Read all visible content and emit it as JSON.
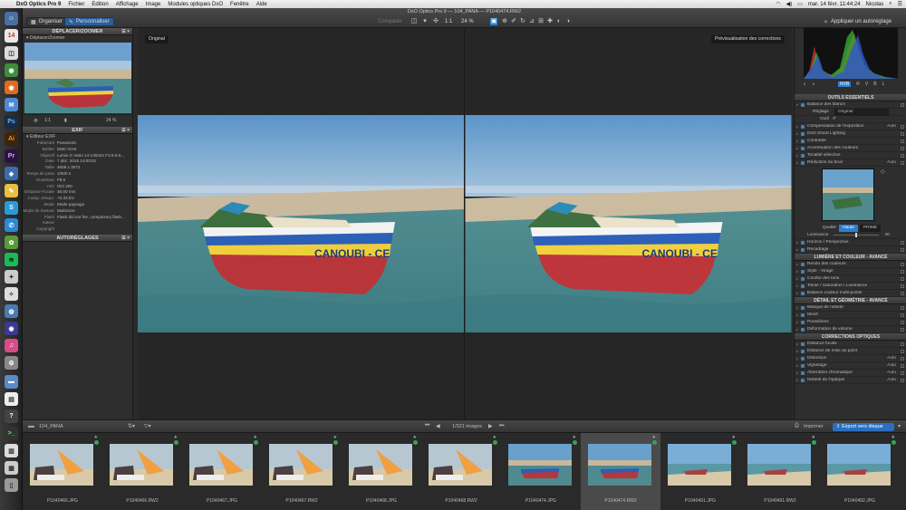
{
  "menubar": {
    "app": "DxO Optics Pro 9",
    "items": [
      "Fichier",
      "Edition",
      "Affichage",
      "Image",
      "Modules optiques DxO",
      "Fenêtre",
      "Aide"
    ],
    "clock": "mar. 14 févr. 11:44:24",
    "user": "Nicolas"
  },
  "toolbar": {
    "window_title": "DxO Optics Pro 9 — 104_PANA — P1040474.RW2",
    "tab_organize": "Organiser",
    "tab_customize": "Personnaliser",
    "compare_label": "Comparer",
    "zoom_ratio": "1:1",
    "zoom_percent": "24 %",
    "auto_apply": "Appliquer un autoréglage"
  },
  "left": {
    "nav_header": "DÉPLACER/ZOOMER",
    "nav_sub": "Déplacer/Zoomer",
    "nav_ratio": "1:1",
    "nav_zoom": "24 %",
    "exif_header": "EXIF",
    "exif_sub": "Éditeur EXIF",
    "exif_rows": [
      {
        "k": "Fabricant",
        "v": "Panasonic"
      },
      {
        "k": "Boîtier",
        "v": "DMC-GH4"
      },
      {
        "k": "Objectif",
        "v": "Lumix G Vario 14-140mm F3.5-5.6..."
      },
      {
        "k": "Date",
        "v": "7 déc. 2015 14:00:01"
      },
      {
        "k": "Taille",
        "v": "4608 x 3072"
      },
      {
        "k": "Temps de pose",
        "v": "1/500 s"
      },
      {
        "k": "Ouverture",
        "v": "F8.0"
      },
      {
        "k": "ISO",
        "v": "ISO 200"
      },
      {
        "k": "Distance Focale",
        "v": "48.00 mm"
      },
      {
        "k": "Comp. d'expo.",
        "v": "+0.33 EV"
      },
      {
        "k": "Mode",
        "v": "Mode paysage"
      },
      {
        "k": "Mode de mesure",
        "v": "Multizone"
      },
      {
        "k": "Flash",
        "v": "Flash did not fire, compulsory flash..."
      },
      {
        "k": "Auteur",
        "v": ""
      },
      {
        "k": "Copyright",
        "v": ""
      }
    ],
    "auto_header": "AUTORÉGLAGES"
  },
  "main": {
    "left_badge": "Original",
    "right_badge": "Prévisualisation des corrections"
  },
  "right": {
    "hist_channels": [
      "RVB",
      "R",
      "V",
      "B",
      "L"
    ],
    "essentials_header": "OUTILS ESSENTIELS",
    "wb_label": "Balance des blancs",
    "wb_setting_label": "Réglage",
    "wb_setting_value": "Original",
    "wb_tool_label": "Outil",
    "tools_a": [
      {
        "label": "Compensation de l'exposition",
        "val": "Auto"
      },
      {
        "label": "DxO Smart Lighting",
        "val": ""
      },
      {
        "label": "Contraste",
        "val": ""
      },
      {
        "label": "Accentuation des couleurs",
        "val": ""
      },
      {
        "label": "Tonalité sélective",
        "val": ""
      },
      {
        "label": "Réduction du bruit",
        "val": "Auto"
      }
    ],
    "noise_quality_label": "Qualité",
    "noise_q_high": "Haute",
    "noise_q_prime": "PRIME",
    "noise_lum_label": "Luminance",
    "noise_lum_value": "40",
    "tools_b": [
      {
        "label": "Horizon / Perspective",
        "val": ""
      },
      {
        "label": "Recadrage",
        "val": ""
      }
    ],
    "color_header": "LUMIÈRE ET COULEUR - AVANCÉ",
    "tools_c": [
      {
        "label": "Rendu des couleurs",
        "val": ""
      },
      {
        "label": "Style - Virage",
        "val": ""
      },
      {
        "label": "Courbe des tons",
        "val": ""
      },
      {
        "label": "Teinte / Saturation / Luminance",
        "val": ""
      },
      {
        "label": "Balance couleur multi-points",
        "val": ""
      }
    ],
    "detail_header": "DÉTAIL ET GÉOMÉTRIE - AVANCÉ",
    "tools_d": [
      {
        "label": "Masque de netteté",
        "val": ""
      },
      {
        "label": "Moiré",
        "val": ""
      },
      {
        "label": "Poussières",
        "val": ""
      },
      {
        "label": "Déformation de volume",
        "val": ""
      }
    ],
    "optics_header": "CORRECTIONS OPTIQUES",
    "tools_e": [
      {
        "label": "Distance focale",
        "val": ""
      },
      {
        "label": "Distance de mise au point",
        "val": ""
      },
      {
        "label": "Distorsion",
        "val": "Auto"
      },
      {
        "label": "Vignetage",
        "val": "Auto"
      },
      {
        "label": "Aberration chromatique",
        "val": "Auto"
      },
      {
        "label": "Netteté de l'optique",
        "val": "Auto"
      }
    ]
  },
  "filmbar": {
    "folder": "104_PANA",
    "count": "1/521 images",
    "print": "Imprimer",
    "export": "Export vers disque"
  },
  "film": [
    {
      "name": "P1040466.JPG",
      "kind": "beach",
      "sel": false
    },
    {
      "name": "P1040466.RW2",
      "kind": "beach",
      "sel": false
    },
    {
      "name": "P1040467.JPG",
      "kind": "beach",
      "sel": false
    },
    {
      "name": "P1040467.RW2",
      "kind": "beach",
      "sel": false
    },
    {
      "name": "P1040468.JPG",
      "kind": "beach",
      "sel": false
    },
    {
      "name": "P1040468.RW2",
      "kind": "beach",
      "sel": false
    },
    {
      "name": "P1040474.JPG",
      "kind": "boat",
      "sel": false
    },
    {
      "name": "P1040474.RW2",
      "kind": "boat",
      "sel": true
    },
    {
      "name": "P1040491.JPG",
      "kind": "sea",
      "sel": false
    },
    {
      "name": "P1040491.RW2",
      "kind": "sea",
      "sel": false
    },
    {
      "name": "P1040492.JPG",
      "kind": "sea",
      "sel": false
    }
  ],
  "colors": {
    "accent": "#2a7fd4",
    "export_bg": "#2a6fc0",
    "badge_ok": "#3aa24a"
  },
  "boat_text": "CANOUBI - CE"
}
